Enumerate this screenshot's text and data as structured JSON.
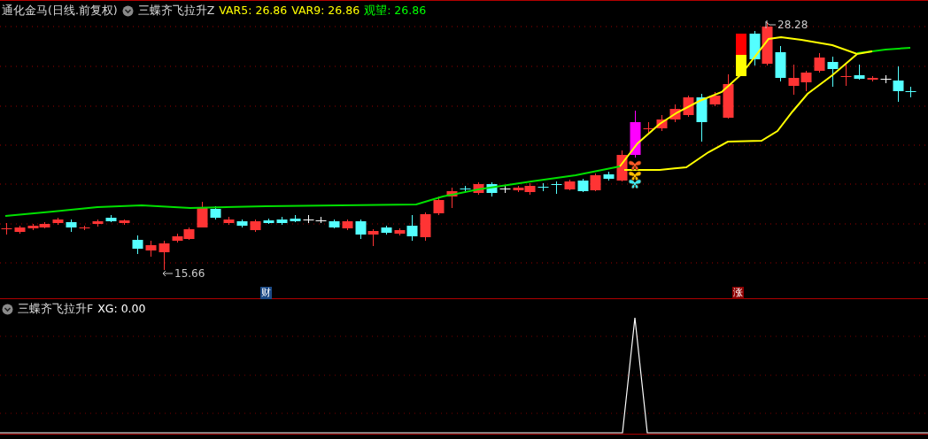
{
  "price_panel": {
    "title": "通化金马(日线.前复权)",
    "indicator": "三蝶齐飞拉升Z",
    "values": [
      {
        "label": "VAR5: 26.86",
        "color": "#ffff00"
      },
      {
        "label": "VAR9: 26.86",
        "color": "#ffff00"
      },
      {
        "label": "观望: 26.86",
        "color": "#00ff00"
      }
    ],
    "high_label": "28.28",
    "low_label": "15.66",
    "event_marks": [
      {
        "text": "财",
        "color": "#1c4a86"
      },
      {
        "text": "涨",
        "color": "#8e0000"
      }
    ]
  },
  "signal_panel": {
    "indicator": "三蝶齐飞拉升F",
    "values": [
      {
        "label": "XG: 0.00",
        "color": "#ffffff"
      }
    ]
  }
}
